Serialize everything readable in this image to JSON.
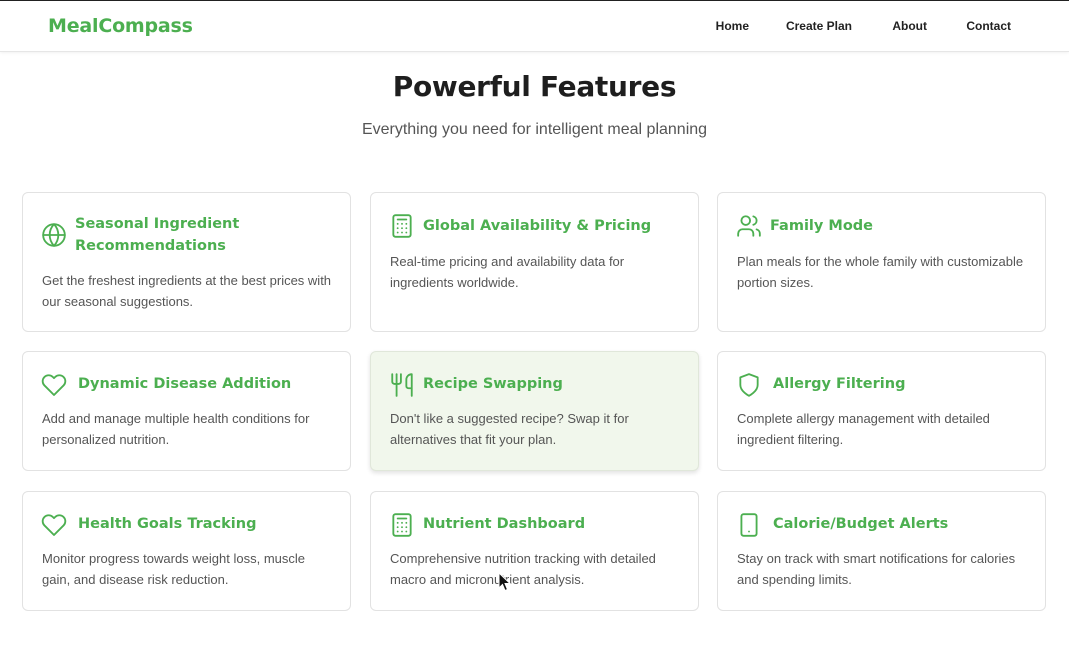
{
  "brand": {
    "name": "MealCompass",
    "color": "#4caf50"
  },
  "nav": [
    {
      "label": "Home"
    },
    {
      "label": "Create Plan"
    },
    {
      "label": "About"
    },
    {
      "label": "Contact"
    }
  ],
  "hero": {
    "title": "Powerful Features",
    "subtitle": "Everything you need for intelligent meal planning"
  },
  "features": [
    {
      "icon": "globe-icon",
      "title": "Seasonal Ingredient Recommendations",
      "description": "Get the freshest ingredients at the best prices with our seasonal suggestions."
    },
    {
      "icon": "calculator-icon",
      "title": "Global Availability & Pricing",
      "description": "Real-time pricing and availability data for ingredients worldwide."
    },
    {
      "icon": "users-icon",
      "title": "Family Mode",
      "description": "Plan meals for the whole family with customizable portion sizes."
    },
    {
      "icon": "heart-icon",
      "title": "Dynamic Disease Addition",
      "description": "Add and manage multiple health conditions for personalized nutrition."
    },
    {
      "icon": "utensils-icon",
      "title": "Recipe Swapping",
      "description": "Don't like a suggested recipe? Swap it for alternatives that fit your plan.",
      "highlighted": true
    },
    {
      "icon": "shield-icon",
      "title": "Allergy Filtering",
      "description": "Complete allergy management with detailed ingredient filtering."
    },
    {
      "icon": "heart-icon",
      "title": "Health Goals Tracking",
      "description": "Monitor progress towards weight loss, muscle gain, and disease risk reduction."
    },
    {
      "icon": "calculator-icon",
      "title": "Nutrient Dashboard",
      "description": "Comprehensive nutrition tracking with detailed macro and micronutrient analysis."
    },
    {
      "icon": "smartphone-icon",
      "title": "Calorie/Budget Alerts",
      "description": "Stay on track with smart notifications for calories and spending limits."
    }
  ]
}
